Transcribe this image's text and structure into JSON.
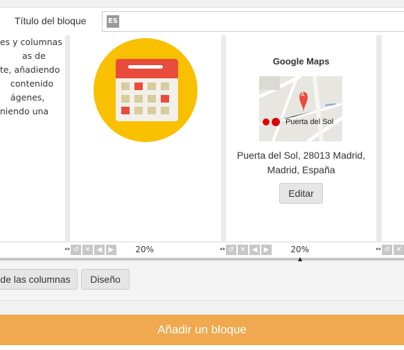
{
  "block_title": {
    "label": "Título del bloque",
    "lang_badge": "ES",
    "value": ""
  },
  "columns": {
    "text_column": {
      "lines": [
        "es y columnas",
        "as de",
        "te, añadiendo",
        "contenido",
        "ágenes,",
        "niendo una"
      ]
    },
    "calendar_column": {
      "icon": "calendar-icon",
      "colors": {
        "circle": "#f9c000",
        "header": "#e94b3c",
        "body": "#f2f0e9",
        "cell": "#d6cc9c",
        "cell_highlight": "#e94b3c"
      }
    },
    "maps_column": {
      "title": "Google Maps",
      "map_label": "Puerta del Sol",
      "map_marker": "A",
      "address_lines": [
        "Puerta del Sol, 28013 Madrid,",
        "Madrid, España"
      ],
      "edit_label": "Editar"
    }
  },
  "column_controls": [
    {
      "width_value": ""
    },
    {
      "width_value": "20%"
    },
    {
      "width_value": "20%"
    }
  ],
  "buttons": {
    "columns_label": "de las columnas",
    "design_label": "Diseño",
    "add_block_label": "Añadir un bloque"
  },
  "colors": {
    "accent": "#f0a94e",
    "control_icon": "#c7c7c7"
  }
}
